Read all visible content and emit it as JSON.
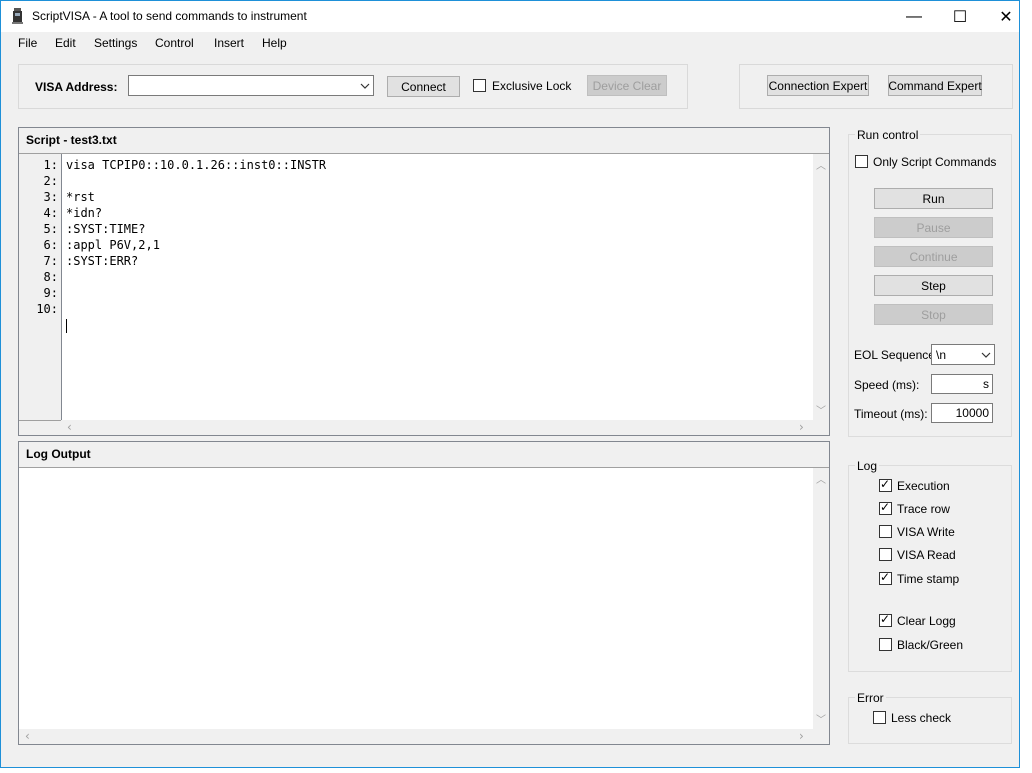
{
  "window": {
    "title": "ScriptVISA - A tool to send commands to instrument"
  },
  "titlebar": {
    "minimize": "—",
    "maximize": "☐",
    "close": "✕"
  },
  "menu": [
    "File",
    "Edit",
    "Settings",
    "Control",
    "Insert",
    "Help"
  ],
  "connection": {
    "visa_label": "VISA Address:",
    "visa_value": "",
    "connect": "Connect",
    "exclusive_lock": "Exclusive Lock",
    "device_clear": "Device Clear",
    "connection_expert": "Connection Expert",
    "command_expert": "Command Expert"
  },
  "script": {
    "title": "Script - test3.txt",
    "line_numbers": [
      "1:",
      "2:",
      "3:",
      "4:",
      "5:",
      "6:",
      "7:",
      "8:",
      "9:",
      "10:"
    ],
    "lines": [
      "visa TCPIP0::10.0.1.26::inst0::INSTR",
      "",
      "*rst",
      "*idn?",
      ":SYST:TIME?",
      ":appl P6V,2,1",
      ":SYST:ERR?",
      "",
      "",
      "",
      ""
    ]
  },
  "log_output": {
    "title": "Log Output"
  },
  "run_control": {
    "title": "Run control",
    "only_script": {
      "label": "Only Script Commands",
      "checked": false
    },
    "run": "Run",
    "pause": "Pause",
    "continue": "Continue",
    "step": "Step",
    "stop": "Stop",
    "eol_label": "EOL Sequence:",
    "eol_value": "\\n",
    "speed_label": "Speed (ms):",
    "speed_value": "s",
    "timeout_label": "Timeout (ms):",
    "timeout_value": "10000"
  },
  "log": {
    "title": "Log",
    "execution": {
      "label": "Execution",
      "checked": true
    },
    "trace_row": {
      "label": "Trace row",
      "checked": true
    },
    "visa_write": {
      "label": "VISA Write",
      "checked": false
    },
    "visa_read": {
      "label": "VISA Read",
      "checked": false
    },
    "time_stamp": {
      "label": "Time stamp",
      "checked": true
    },
    "clear_logg": {
      "label": "Clear Logg",
      "checked": true
    },
    "black_green": {
      "label": "Black/Green",
      "checked": false
    }
  },
  "error": {
    "title": "Error",
    "less_check": {
      "label": "Less check",
      "checked": false
    }
  },
  "icons": {
    "app": "instrument-icon",
    "dropdown": "chevron-down-icon",
    "scroll_up": "arrow-up-icon",
    "scroll_down": "arrow-down-icon",
    "scroll_left": "arrow-left-icon",
    "scroll_right": "arrow-right-icon"
  }
}
